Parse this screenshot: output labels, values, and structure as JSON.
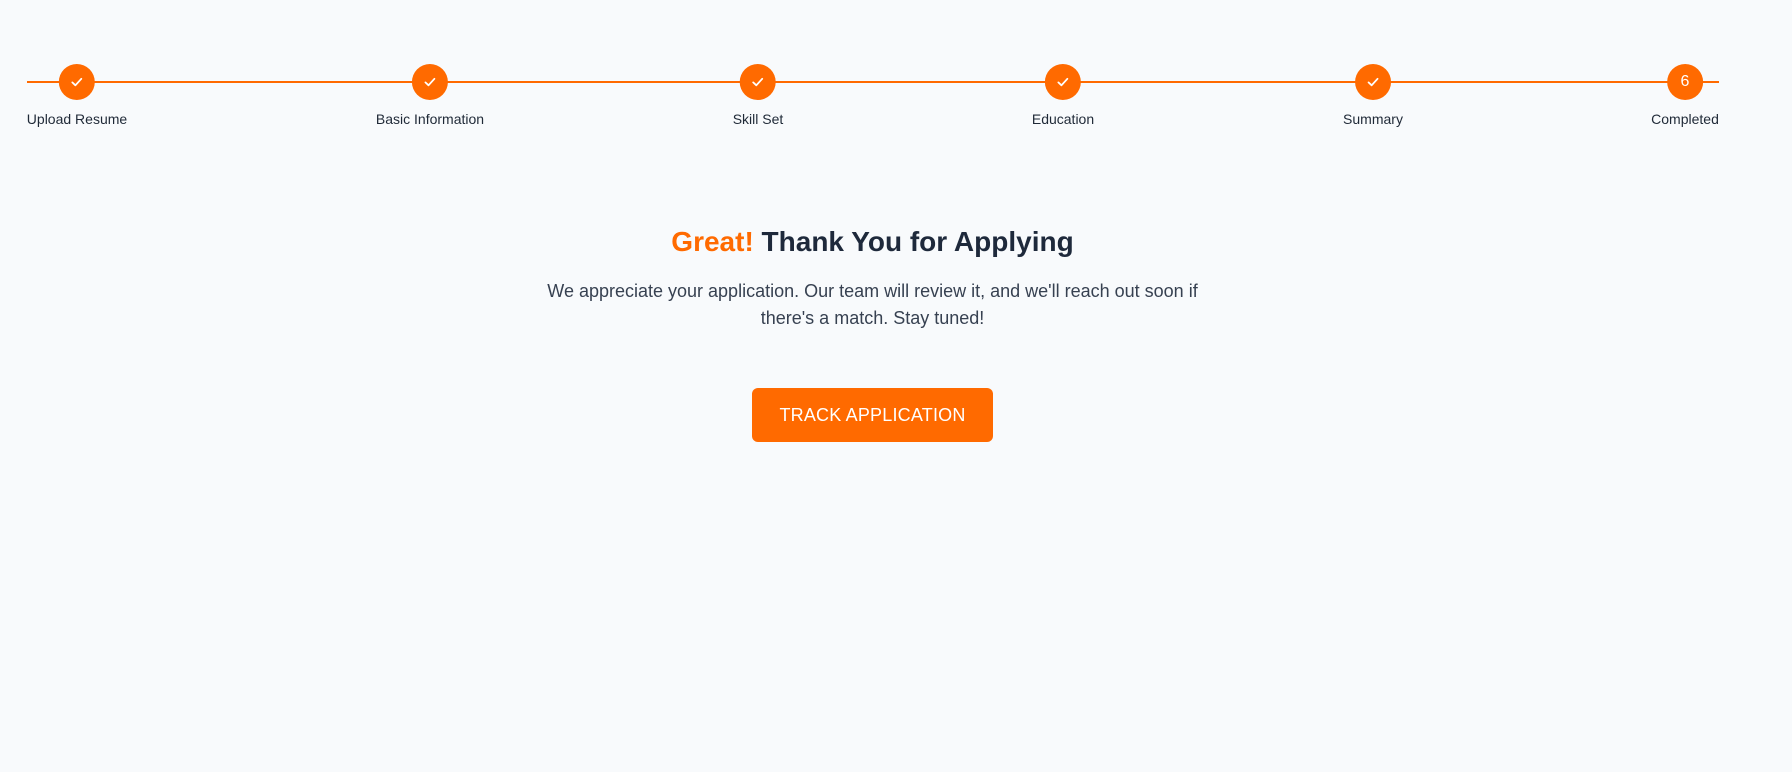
{
  "theme": {
    "accent": "#ff6a00",
    "background": "#f8fafc",
    "heading": "#1e293b",
    "body_text": "#374151"
  },
  "stepper": {
    "steps": [
      {
        "label": "Upload Resume",
        "status": "completed",
        "icon": "check-icon"
      },
      {
        "label": "Basic Information",
        "status": "completed",
        "icon": "check-icon"
      },
      {
        "label": "Skill Set",
        "status": "completed",
        "icon": "check-icon"
      },
      {
        "label": "Education",
        "status": "completed",
        "icon": "check-icon"
      },
      {
        "label": "Summary",
        "status": "completed",
        "icon": "check-icon"
      },
      {
        "label": "Completed",
        "status": "current",
        "number": "6"
      }
    ]
  },
  "confirmation": {
    "title_accent": "Great!",
    "title_rest": "Thank You for Applying",
    "message": "We appreciate your application. Our team will review it, and we'll reach out soon if there's a match. Stay tuned!",
    "button_label": "TRACK APPLICATION"
  }
}
